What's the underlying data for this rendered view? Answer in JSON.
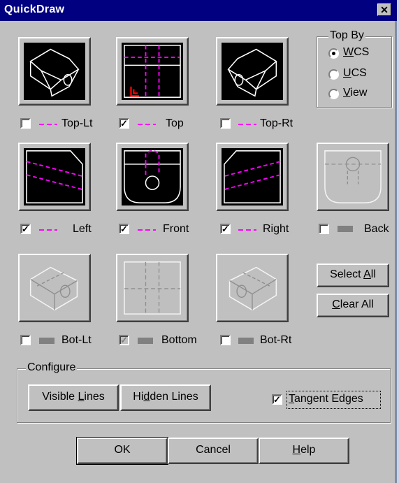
{
  "window": {
    "title": "QuickDraw",
    "close_glyph": "✕"
  },
  "views": [
    {
      "label": "Top-Lt",
      "checked": false,
      "enabled": true
    },
    {
      "label": "Top",
      "checked": true,
      "enabled": true
    },
    {
      "label": "Top-Rt",
      "checked": false,
      "enabled": true
    },
    {
      "label": "Left",
      "checked": true,
      "enabled": true
    },
    {
      "label": "Front",
      "checked": true,
      "enabled": true
    },
    {
      "label": "Right",
      "checked": true,
      "enabled": true
    },
    {
      "label": "Back",
      "checked": false,
      "enabled": false
    },
    {
      "label": "Bot-Lt",
      "checked": false,
      "enabled": false
    },
    {
      "label": "Bottom",
      "checked": true,
      "enabled": false
    },
    {
      "label": "Bot-Rt",
      "checked": false,
      "enabled": false
    }
  ],
  "top_by": {
    "label": "Top By",
    "options": [
      {
        "pre": "",
        "acc": "W",
        "post": "CS",
        "selected": true
      },
      {
        "pre": "",
        "acc": "U",
        "post": "CS",
        "selected": false
      },
      {
        "pre": "",
        "acc": "V",
        "post": "iew",
        "selected": false
      }
    ]
  },
  "select_all": {
    "pre": "Select ",
    "acc": "A",
    "post": "ll"
  },
  "clear_all": {
    "pre": "",
    "acc": "C",
    "post": "lear All"
  },
  "configure": {
    "label": "Configure",
    "visible_lines": {
      "pre": "Visible ",
      "acc": "L",
      "post": "ines"
    },
    "hidden_lines": {
      "pre": "Hi",
      "acc": "d",
      "post": "den Lines"
    },
    "tangent_edges": {
      "pre": "",
      "acc": "T",
      "post": "angent Edges",
      "checked": true
    }
  },
  "footer": {
    "ok": "OK",
    "cancel": "Cancel",
    "help": {
      "pre": "",
      "acc": "H",
      "post": "elp"
    }
  },
  "colors": {
    "title_bg": "#000080",
    "dialog_bg": "#c0c0c0",
    "hidden_line": "#ff00ff"
  }
}
